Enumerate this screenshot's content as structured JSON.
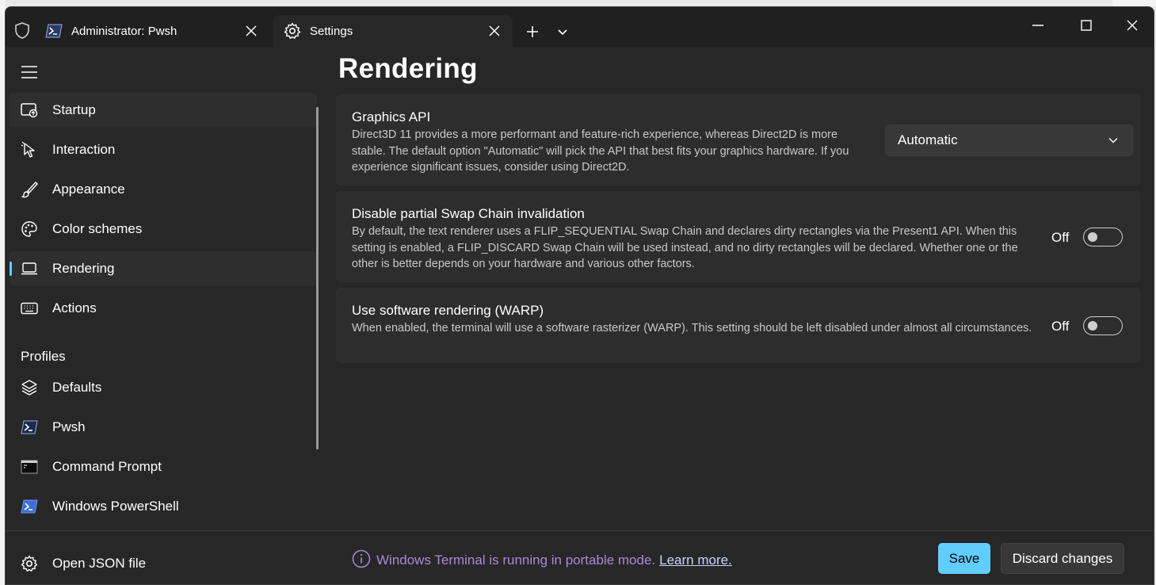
{
  "tabs": [
    {
      "label": "Administrator: Pwsh",
      "icon": "powershell-icon"
    },
    {
      "label": "Settings",
      "icon": "gear-icon"
    }
  ],
  "sidebar": {
    "items": [
      {
        "label": "Startup",
        "icon": "startup-icon"
      },
      {
        "label": "Interaction",
        "icon": "cursor-icon"
      },
      {
        "label": "Appearance",
        "icon": "brush-icon"
      },
      {
        "label": "Color schemes",
        "icon": "palette-icon"
      },
      {
        "label": "Rendering",
        "icon": "laptop-icon"
      },
      {
        "label": "Actions",
        "icon": "keyboard-icon"
      }
    ],
    "profiles_heading": "Profiles",
    "profiles": [
      {
        "label": "Defaults",
        "icon": "layers-icon"
      },
      {
        "label": "Pwsh",
        "icon": "powershell-icon"
      },
      {
        "label": "Command Prompt",
        "icon": "cmd-icon"
      },
      {
        "label": "Windows PowerShell",
        "icon": "powershell-icon"
      }
    ],
    "open_json": "Open JSON file"
  },
  "main": {
    "title": "Rendering",
    "graphics_api": {
      "title": "Graphics API",
      "description": "Direct3D 11 provides a more performant and feature-rich experience, whereas Direct2D is more stable. The default option \"Automatic\" will pick the API that best fits your graphics hardware. If you experience significant issues, consider using Direct2D.",
      "selected": "Automatic"
    },
    "swap_chain": {
      "title": "Disable partial Swap Chain invalidation",
      "description": "By default, the text renderer uses a FLIP_SEQUENTIAL Swap Chain and declares dirty rectangles via the Present1 API. When this setting is enabled, a FLIP_DISCARD Swap Chain will be used instead, and no dirty rectangles will be declared. Whether one or the other is better depends on your hardware and various other factors.",
      "state": "Off"
    },
    "warp": {
      "title": "Use software rendering (WARP)",
      "description": "When enabled, the terminal will use a software rasterizer (WARP). This setting should be left disabled under almost all circumstances.",
      "state": "Off"
    }
  },
  "footer": {
    "info": "Windows Terminal is running in portable mode.",
    "link": "Learn more.",
    "save": "Save",
    "discard": "Discard changes"
  },
  "colors": {
    "accent": "#60cdff",
    "info": "#a98ad8"
  }
}
